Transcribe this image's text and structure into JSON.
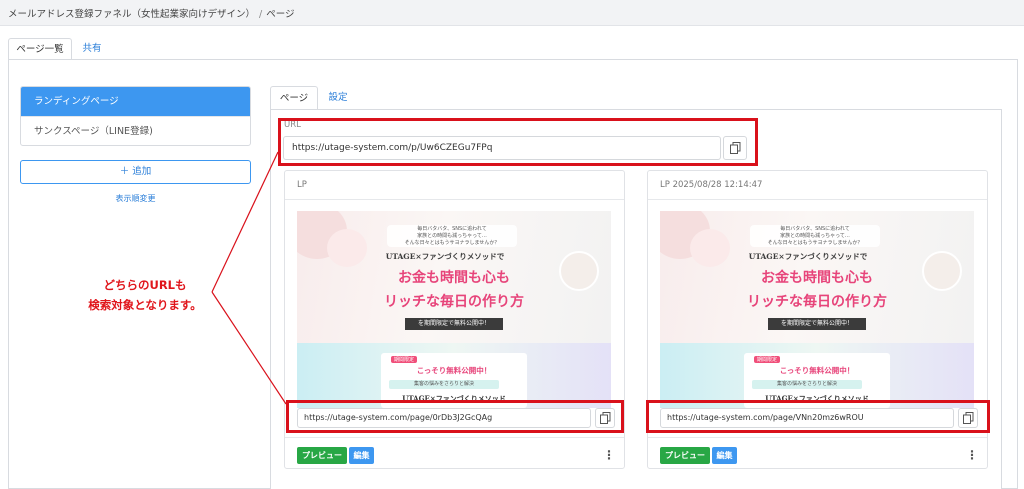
{
  "breadcrumb": {
    "funnel": "メールアドレス登録ファネル（女性起業家向けデザイン）",
    "separator": "/",
    "page": "ページ"
  },
  "main_tabs": [
    {
      "label": "ページ一覧",
      "active": true
    },
    {
      "label": "共有",
      "active": false
    }
  ],
  "sidebar": {
    "items": [
      {
        "label": "ランディングページ",
        "active": true
      },
      {
        "label": "サンクスページ（LINE登録)",
        "active": false
      }
    ],
    "add_label": "＋ 追加",
    "reorder_label": "表示順変更"
  },
  "sub_tabs": [
    {
      "label": "ページ",
      "active": true
    },
    {
      "label": "設定",
      "active": false
    }
  ],
  "url_section": {
    "label": "URL",
    "value": "https://utage-system.com/p/Uw6CZEGu7FPq"
  },
  "callout": {
    "line1": "どちらのURLも",
    "line2": "検索対象となります。"
  },
  "cards": [
    {
      "header": "LP",
      "url": "https://utage-system.com/page/0rDb3J2GcQAg",
      "preview_label": "プレビュー",
      "edit_label": "編集"
    },
    {
      "header": "LP 2025/08/28 12:14:47",
      "url": "https://utage-system.com/page/VNn20mz6wROU",
      "preview_label": "プレビュー",
      "edit_label": "編集"
    }
  ],
  "thumbnail": {
    "bubble_line1": "毎日バタバタ、SNSに追われて",
    "bubble_line2": "家族との時間も減っちゃって…",
    "bubble_line3": "そんな日々とはもうサヨナラしませんか？",
    "title": "UTAGE×ファンづくりメソッドで",
    "headline1": "お金も時間も心も",
    "headline2": "リッチな毎日の作り方",
    "banner": "を期間限定で無料公開中！",
    "promo_badge": "期間限定",
    "promo_title": "こっそり無料公開中！",
    "promo_sub": "集客の悩みをさらりと解決",
    "promo_bottom": "UTAGE×ファンづくりメソッド"
  },
  "colors": {
    "accent": "#3d97f0",
    "highlight": "#d9111b",
    "preview_button": "#28a745",
    "link": "#2a7ed8"
  },
  "icons": {
    "copy": "copy-icon",
    "menu": "kebab-menu-icon"
  }
}
